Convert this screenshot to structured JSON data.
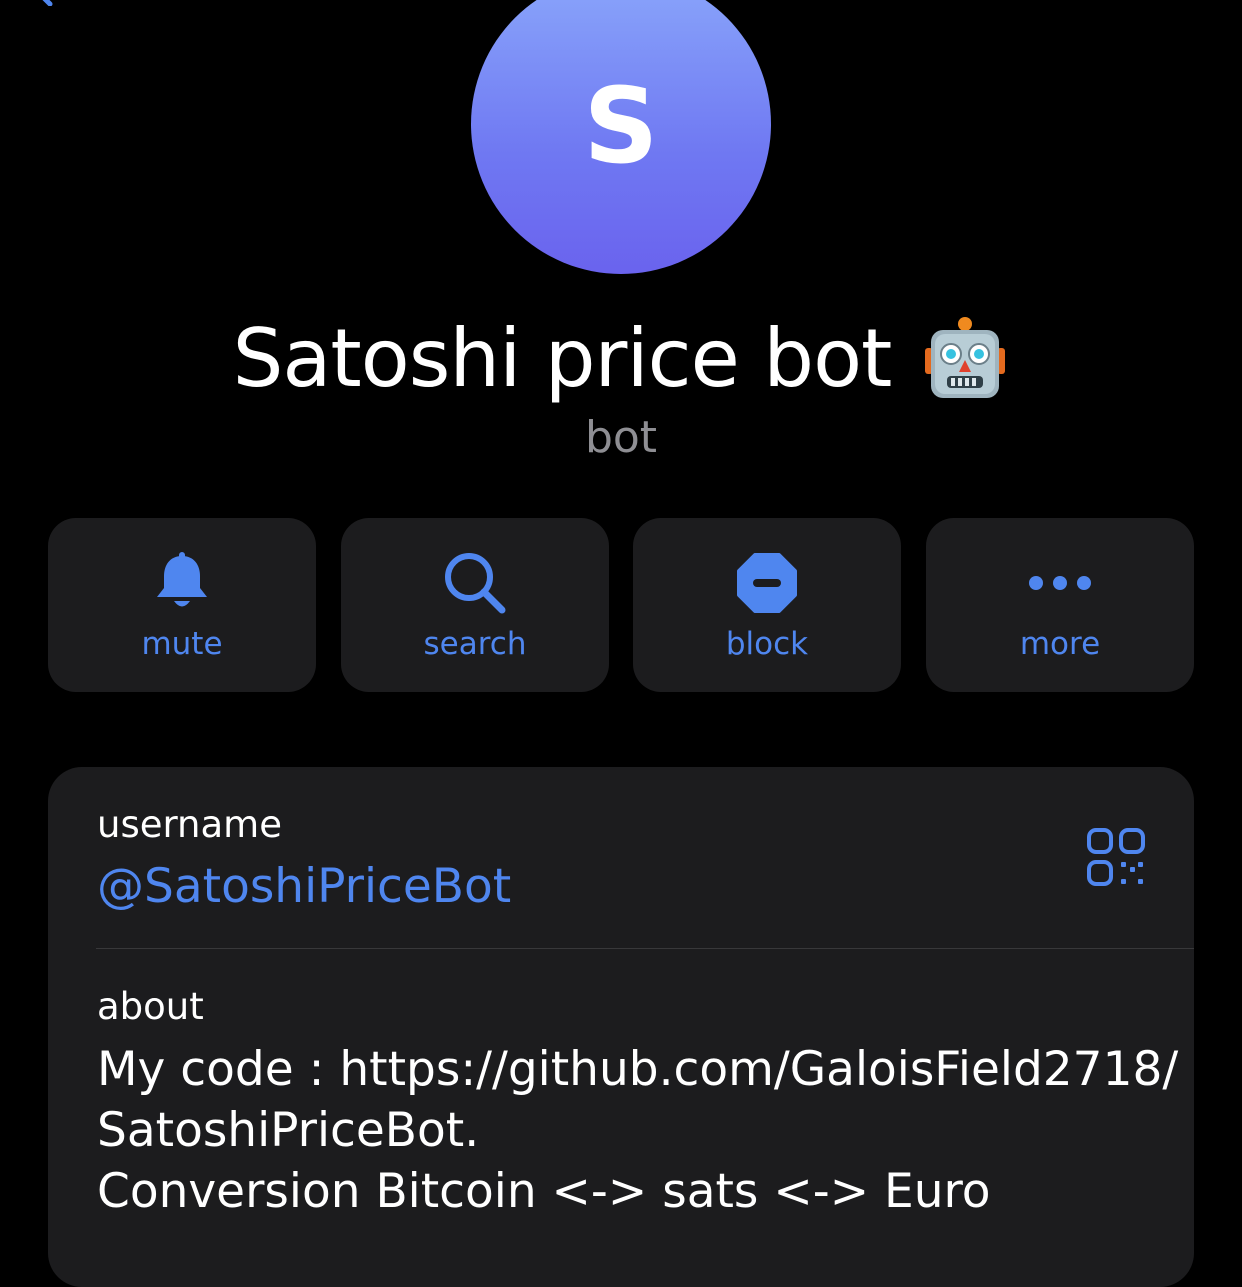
{
  "header": {
    "back_icon": "chevron-left-icon"
  },
  "profile": {
    "avatar_letter": "S",
    "name": "Satoshi price bot",
    "name_emoji": "robot-face-icon",
    "subtitle": "bot",
    "avatar_gradient": [
      "#8aa6fb",
      "#6a63ee"
    ]
  },
  "actions": [
    {
      "label": "mute",
      "icon": "bell-icon"
    },
    {
      "label": "search",
      "icon": "search-icon"
    },
    {
      "label": "block",
      "icon": "block-icon"
    },
    {
      "label": "more",
      "icon": "more-icon"
    }
  ],
  "info": {
    "username_label": "username",
    "username_value": "@SatoshiPriceBot",
    "qr_icon": "qr-code-icon",
    "about_label": "about",
    "about_lines": [
      "My code : https://github.com/GaloisField2718/",
      "SatoshiPriceBot.",
      "Conversion Bitcoin <-> sats <-> Euro"
    ]
  },
  "colors": {
    "background": "#000000",
    "card": "#1c1c1e",
    "accent": "#4f86ef",
    "secondary_text": "#8e8e93",
    "divider": "#38383a"
  }
}
